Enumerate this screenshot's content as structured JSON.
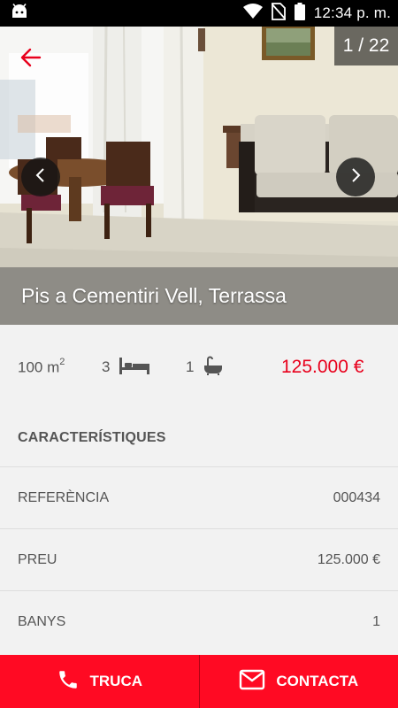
{
  "status_bar": {
    "time": "12:34 p. m.",
    "icons": [
      "android-icon",
      "wifi-icon",
      "no-sim-icon",
      "battery-icon"
    ]
  },
  "gallery": {
    "counter": "1 / 22",
    "title": "Pis a Cementiri Vell, Terrassa",
    "back_icon": "arrow-left-icon",
    "prev_icon": "chevron-left-icon",
    "next_icon": "chevron-right-icon"
  },
  "summary": {
    "area_value": "100 m",
    "area_unit_sup": "2",
    "bedrooms": "3",
    "bathrooms": "1",
    "price": "125.000 €"
  },
  "characteristics": {
    "title": "CARACTERÍSTIQUES",
    "rows": [
      {
        "label": "REFERÈNCIA",
        "value": "000434"
      },
      {
        "label": "PREU",
        "value": "125.000 €"
      },
      {
        "label": "BANYS",
        "value": "1"
      }
    ]
  },
  "actions": {
    "call_label": "TRUCA",
    "contact_label": "CONTACTA"
  },
  "colors": {
    "accent": "#ff0a23",
    "price": "#e8001c",
    "text": "#555555",
    "background": "#f2f2f2"
  }
}
